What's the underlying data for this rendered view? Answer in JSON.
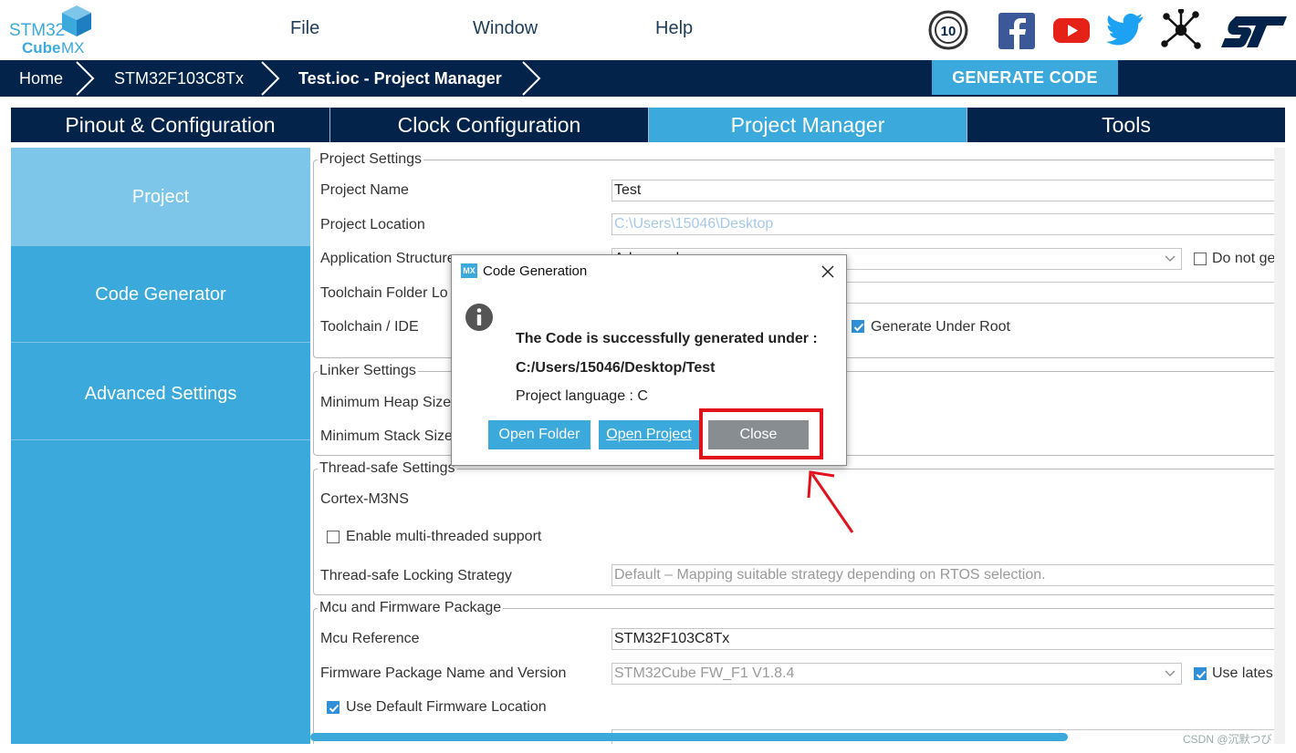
{
  "header": {
    "logo_line1": "STM32",
    "logo_line2a": "Cube",
    "logo_line2b": "MX",
    "menu": [
      "File",
      "Window",
      "Help"
    ],
    "anniversary_badge": "10",
    "social_icons": [
      "anniversary-badge-icon",
      "facebook-icon",
      "youtube-icon",
      "twitter-icon",
      "network-icon",
      "st-logo-icon"
    ]
  },
  "breadcrumb": {
    "items": [
      "Home",
      "STM32F103C8Tx",
      "Test.ioc - Project Manager"
    ],
    "generate_label": "GENERATE CODE"
  },
  "tabs": [
    {
      "label": "Pinout & Configuration",
      "active": false
    },
    {
      "label": "Clock Configuration",
      "active": false
    },
    {
      "label": "Project Manager",
      "active": true
    },
    {
      "label": "Tools",
      "active": false
    }
  ],
  "sidebar": {
    "items": [
      {
        "label": "Project",
        "active": true
      },
      {
        "label": "Code Generator",
        "active": false
      },
      {
        "label": "Advanced Settings",
        "active": false
      }
    ]
  },
  "project_settings": {
    "legend": "Project Settings",
    "project_name_label": "Project Name",
    "project_name_value": "Test",
    "project_location_label": "Project Location",
    "project_location_value": "C:\\Users\\15046\\Desktop",
    "app_structure_label": "Application Structure",
    "app_structure_value": "Advanced",
    "do_not_generate_label": "Do not ge",
    "toolchain_folder_label": "Toolchain Folder Lo",
    "toolchain_ide_label": "Toolchain / IDE",
    "generate_under_root_label": "Generate Under Root"
  },
  "linker_settings": {
    "legend": "Linker Settings",
    "heap_label": "Minimum Heap Size",
    "stack_label": "Minimum Stack Size"
  },
  "thread_safe": {
    "legend": "Thread-safe Settings",
    "core_label": "Cortex-M3NS",
    "multi_thread_label": "Enable multi-threaded support",
    "locking_label": "Thread-safe Locking Strategy",
    "locking_value": "Default  –  Mapping suitable strategy depending on RTOS selection."
  },
  "mcu_firmware": {
    "legend": "Mcu and Firmware Package",
    "mcu_ref_label": "Mcu Reference",
    "mcu_ref_value": "STM32F103C8Tx",
    "fw_label": "Firmware Package Name and Version",
    "fw_value": "STM32Cube FW_F1 V1.8.4",
    "use_latest_label": "Use lates",
    "default_fw_label": "Use Default Firmware Location"
  },
  "dialog": {
    "badge": "MX",
    "title": "Code Generation",
    "line1": "The Code is successfully generated under :",
    "line2": "C:/Users/15046/Desktop/Test",
    "line3": "Project language : C",
    "buttons": [
      "Open Folder",
      "Open Project",
      "Close"
    ]
  },
  "watermark": "CSDN @沉默つび",
  "colors": {
    "navy": "#03234b",
    "accent": "#3ba9dc",
    "sidebar_active": "#7dc6ea",
    "highlight_red": "#e1121d",
    "close_grey": "#888d91"
  }
}
